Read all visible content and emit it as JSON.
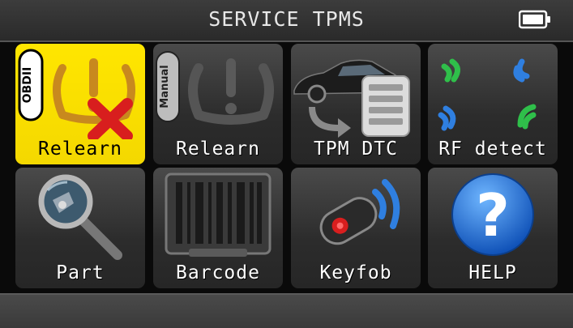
{
  "header": {
    "title": "SERVICE TPMS",
    "battery_icon": "battery-full-icon"
  },
  "tiles": [
    {
      "label": "Relearn",
      "badge": "OBDII",
      "icon": "tire-obdii-relearn-icon",
      "selected": true
    },
    {
      "label": "Relearn",
      "badge": "Manual",
      "icon": "tire-manual-relearn-icon",
      "selected": false
    },
    {
      "label": "TPM DTC",
      "icon": "car-dtc-list-icon",
      "selected": false
    },
    {
      "label": "RF detect",
      "icon": "rf-signal-icon",
      "selected": false
    },
    {
      "label": "Part",
      "icon": "magnifier-part-icon",
      "selected": false
    },
    {
      "label": "Barcode",
      "icon": "barcode-icon",
      "selected": false
    },
    {
      "label": "Keyfob",
      "icon": "keyfob-icon",
      "selected": false
    },
    {
      "label": "HELP",
      "icon": "help-question-icon",
      "selected": false
    }
  ],
  "colors": {
    "selected_tile": "#ffe600",
    "tile_bg": "#3a3a3a",
    "help_blue": "#1e6fd9",
    "rf_green": "#2fbf4a",
    "rf_blue": "#2f7fe0",
    "x_red": "#d81e1e"
  }
}
